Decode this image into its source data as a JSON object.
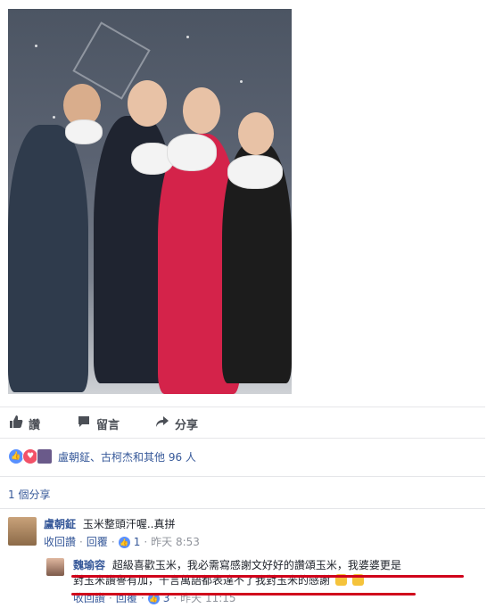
{
  "actions": {
    "like": "讚",
    "comment": "留言",
    "share": "分享"
  },
  "reactions": {
    "names": "盧朝鉦、古柯杰和其他 96 人",
    "icons": [
      "like-icon",
      "love-icon",
      "avatar-icon"
    ],
    "colors": {
      "like": "#5890ff",
      "love": "#f25268"
    }
  },
  "shares": {
    "text": "1 個分享"
  },
  "comments": [
    {
      "name": "盧朝鉦",
      "text": "玉米整頭汗喔..真拼",
      "reply_label": "收回讚",
      "reply": "回覆",
      "likes": "1",
      "time": "昨天 8:53"
    },
    {
      "name": "魏瑜容",
      "text_line1": "超級喜歡玉米，我必需寫感謝文好好的讚頌玉米，我婆婆更是",
      "text_line2": "對玉米讚譽有加，千言萬語都表達不了我對玉米的感謝",
      "reply_label": "收回讚",
      "reply": "回覆",
      "likes": "3",
      "time": "昨天 11:15"
    }
  ],
  "colors": {
    "link": "#365899",
    "meta": "#90949c",
    "highlight_underline": "#d0021b"
  }
}
